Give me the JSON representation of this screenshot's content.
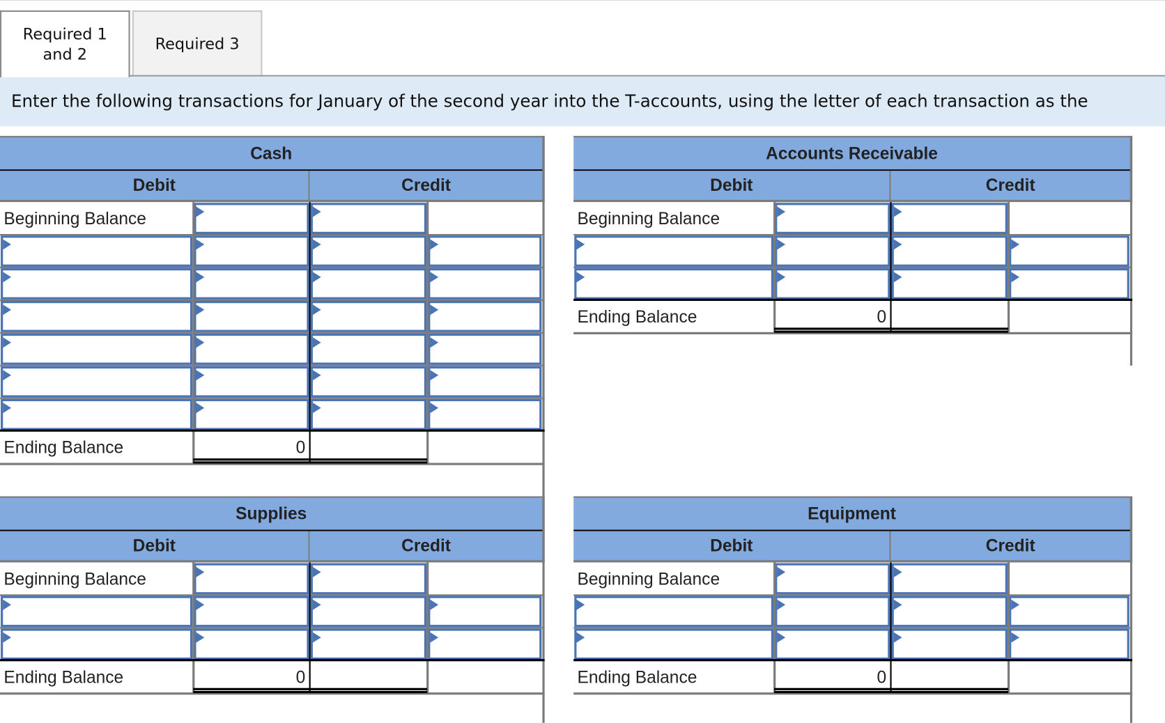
{
  "tabs": [
    {
      "label": "Required 1 and 2",
      "line1": "Required 1",
      "line2": "and 2",
      "active": true
    },
    {
      "label": "Required 3",
      "active": false
    }
  ],
  "instructions": "Enter the following transactions for January of the second year into the T-accounts, using the letter of each transaction as the",
  "colors": {
    "header_blue": "#82aadf",
    "input_border": "#4a74b4",
    "instruction_bg": "#deebf7"
  },
  "accounts": [
    {
      "name": "Cash",
      "debit_label": "Debit",
      "credit_label": "Credit",
      "beginning_label": "Beginning Balance",
      "transaction_rows": 6,
      "ending_label": "Ending Balance",
      "ending_debit": "0",
      "ending_credit": ""
    },
    {
      "name": "Accounts Receivable",
      "debit_label": "Debit",
      "credit_label": "Credit",
      "beginning_label": "Beginning Balance",
      "transaction_rows": 2,
      "ending_label": "Ending Balance",
      "ending_debit": "0",
      "ending_credit": ""
    },
    {
      "name": "Supplies",
      "debit_label": "Debit",
      "credit_label": "Credit",
      "beginning_label": "Beginning Balance",
      "transaction_rows": 2,
      "ending_label": "Ending Balance",
      "ending_debit": "0",
      "ending_credit": ""
    },
    {
      "name": "Equipment",
      "debit_label": "Debit",
      "credit_label": "Credit",
      "beginning_label": "Beginning Balance",
      "transaction_rows": 2,
      "ending_label": "Ending Balance",
      "ending_debit": "0",
      "ending_credit": ""
    }
  ]
}
